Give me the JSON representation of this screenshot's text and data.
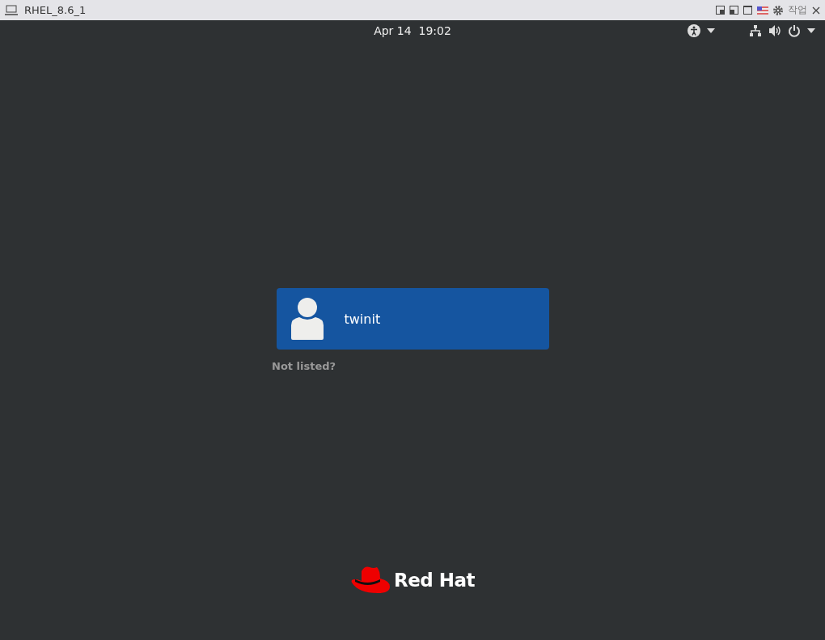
{
  "window": {
    "title": "RHEL_8.6_1",
    "menu_label": "작업"
  },
  "top_bar": {
    "clock": "Apr 14  19:02"
  },
  "users": [
    {
      "name": "twinit",
      "selected": true
    }
  ],
  "not_listed": "Not listed?",
  "logo": {
    "text": "Red Hat"
  }
}
